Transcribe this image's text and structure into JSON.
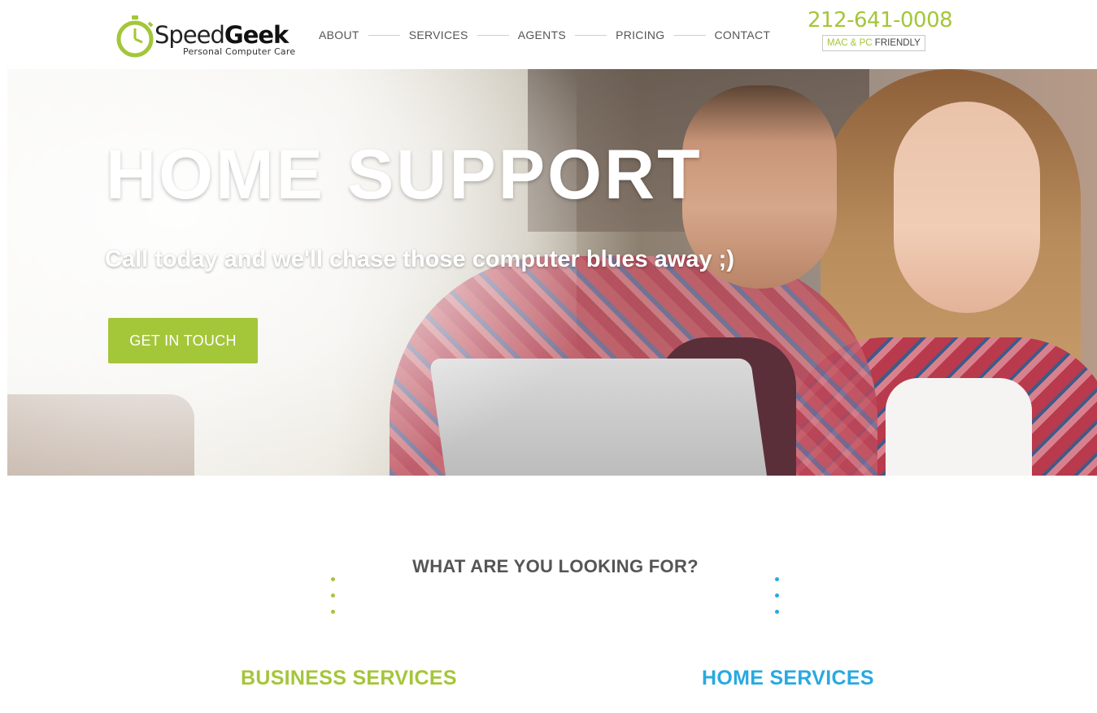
{
  "brand": {
    "name_part1": "Speed",
    "name_part2": "Geek",
    "tagline": "Personal Computer Care",
    "logo_icon": "stopwatch-icon",
    "accent_color": "#a4c639"
  },
  "nav": {
    "items": [
      {
        "label": "ABOUT"
      },
      {
        "label": "SERVICES"
      },
      {
        "label": "AGENTS"
      },
      {
        "label": "PRICING"
      },
      {
        "label": "CONTACT"
      }
    ]
  },
  "contact": {
    "phone": "212-641-0008",
    "badge_part1": "MAC & PC",
    "badge_part2": "FRIENDLY"
  },
  "hero": {
    "title": "HOME SUPPORT",
    "subtitle": "Call today and we'll chase those computer blues away ;)",
    "cta_label": "GET IN TOUCH",
    "cta_color": "#a4c639"
  },
  "section": {
    "title": "WHAT ARE YOU LOOKING FOR?",
    "options": [
      {
        "label": "BUSINESS SERVICES",
        "color": "#a4c639"
      },
      {
        "label": "HOME SERVICES",
        "color": "#29a9e1"
      }
    ]
  }
}
